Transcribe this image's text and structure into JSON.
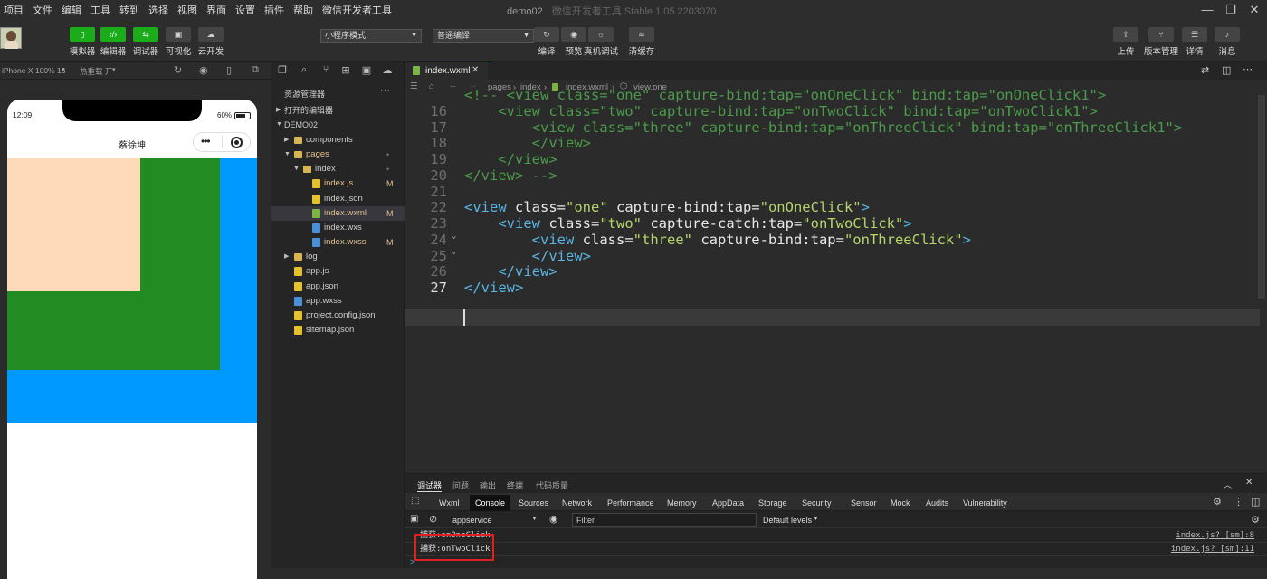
{
  "menu": [
    "项目",
    "文件",
    "编辑",
    "工具",
    "转到",
    "选择",
    "视图",
    "界面",
    "设置",
    "插件",
    "帮助",
    "微信开发者工具"
  ],
  "window": {
    "title": "demo02",
    "subtitle": "微信开发者工具 Stable 1.05.2203070"
  },
  "toolbar": {
    "buttons": [
      {
        "icon": "phone-icon",
        "label": "模拟器"
      },
      {
        "icon": "code-icon",
        "label": "编辑器"
      },
      {
        "icon": "debug-icon",
        "label": "调试器"
      },
      {
        "icon": "visual-icon",
        "label": "可视化"
      },
      {
        "icon": "cloud-icon",
        "label": "云开发"
      }
    ],
    "mode_select": "小程序模式",
    "compile_select": "普通编译",
    "actions": [
      "编译",
      "预览",
      "真机调试",
      "清缓存"
    ],
    "right_actions": [
      "上传",
      "版本管理",
      "详情",
      "消息"
    ]
  },
  "simulator": {
    "device": "iPhone X 100% 16",
    "hotreload": "热重载 开",
    "time": "12:09",
    "battery": "60%",
    "nav_title": "蔡徐坤",
    "colors": {
      "blue": "#0099ff",
      "green": "#228b22",
      "peach": "#ffdab9"
    }
  },
  "explorer": {
    "title": "资源管理器",
    "open_editors": "打开的编辑器",
    "project": "DEMO02",
    "tree": [
      {
        "name": "components",
        "type": "folder",
        "depth": 1,
        "open": false,
        "status": ""
      },
      {
        "name": "pages",
        "type": "folder",
        "depth": 1,
        "open": true,
        "status": "•",
        "color": "#e2c08d"
      },
      {
        "name": "index",
        "type": "folder",
        "depth": 2,
        "open": true,
        "status": "•"
      },
      {
        "name": "index.js",
        "type": "js",
        "depth": 3,
        "status": "M",
        "color": "#e2c08d"
      },
      {
        "name": "index.json",
        "type": "json",
        "depth": 3,
        "status": ""
      },
      {
        "name": "index.wxml",
        "type": "wxml",
        "depth": 3,
        "status": "M",
        "color": "#e2c08d",
        "selected": true
      },
      {
        "name": "index.wxs",
        "type": "wxs",
        "depth": 3,
        "status": ""
      },
      {
        "name": "index.wxss",
        "type": "wxss",
        "depth": 3,
        "status": "M",
        "color": "#e2c08d"
      },
      {
        "name": "log",
        "type": "folder",
        "depth": 1,
        "open": false,
        "status": ""
      },
      {
        "name": "app.js",
        "type": "js",
        "depth": 1,
        "status": ""
      },
      {
        "name": "app.json",
        "type": "json",
        "depth": 1,
        "status": ""
      },
      {
        "name": "app.wxss",
        "type": "wxss",
        "depth": 1,
        "status": ""
      },
      {
        "name": "project.config.json",
        "type": "json",
        "depth": 1,
        "status": ""
      },
      {
        "name": "sitemap.json",
        "type": "json",
        "depth": 1,
        "status": ""
      }
    ]
  },
  "editor": {
    "tab": "index.wxml",
    "breadcrumb": [
      "pages",
      "index",
      "index.wxml",
      "view.one"
    ],
    "lines": [
      {
        "n": "",
        "segs": [
          [
            "cm",
            "<!-- <view class=\"one\" capture-bind:tap=\"onOneClick\" bind:tap=\"onOneClick1\">"
          ]
        ]
      },
      {
        "n": "16",
        "segs": [
          [
            "cm",
            "    <view class=\"two\" capture-bind:tap=\"onTwoClick\" bind:tap=\"onTwoClick1\">"
          ]
        ]
      },
      {
        "n": "17",
        "segs": [
          [
            "cm",
            "        <view class=\"three\" capture-bind:tap=\"onThreeClick\" bind:tap=\"onThreeClick1\">"
          ]
        ]
      },
      {
        "n": "18",
        "segs": [
          [
            "cm",
            "        </view>"
          ]
        ]
      },
      {
        "n": "19",
        "segs": [
          [
            "cm",
            "    </view>"
          ]
        ]
      },
      {
        "n": "20",
        "segs": [
          [
            "cm",
            "</view> -->"
          ]
        ]
      },
      {
        "n": "21",
        "segs": []
      },
      {
        "n": "22",
        "segs": [
          [
            "tg",
            "<view "
          ],
          [
            "at",
            "class="
          ],
          [
            "sv",
            "\"one\" "
          ],
          [
            "at",
            "capture-bind:tap="
          ],
          [
            "sv",
            "\"onOneClick\""
          ],
          [
            "tg",
            ">"
          ]
        ]
      },
      {
        "n": "23",
        "segs": [
          [
            "tg",
            "    <view "
          ],
          [
            "at",
            "class="
          ],
          [
            "sv",
            "\"two\" "
          ],
          [
            "at",
            "capture-catch:tap="
          ],
          [
            "sv",
            "\"onTwoClick\""
          ],
          [
            "tg",
            ">"
          ]
        ]
      },
      {
        "n": "24",
        "segs": [
          [
            "tg",
            "        <view "
          ],
          [
            "at",
            "class="
          ],
          [
            "sv",
            "\"three\" "
          ],
          [
            "at",
            "capture-bind:tap="
          ],
          [
            "sv",
            "\"onThreeClick\""
          ],
          [
            "tg",
            ">"
          ]
        ]
      },
      {
        "n": "25",
        "segs": [
          [
            "tg",
            "        </view>"
          ]
        ]
      },
      {
        "n": "26",
        "segs": [
          [
            "tg",
            "    </view>"
          ]
        ]
      },
      {
        "n": "27",
        "segs": [
          [
            "tg",
            "</view>"
          ]
        ]
      }
    ]
  },
  "devtools": {
    "panel_tabs": [
      "调试器",
      "问题",
      "输出",
      "终端",
      "代码质量"
    ],
    "tabs": [
      "Wxml",
      "Console",
      "Sources",
      "Network",
      "Performance",
      "Memory",
      "AppData",
      "Storage",
      "Security",
      "Sensor",
      "Mock",
      "Audits",
      "Vulnerability"
    ],
    "active_tab": "Console",
    "context": "appservice",
    "filter_placeholder": "Filter",
    "levels": "Default levels",
    "logs": [
      {
        "text": "捕获:onOneClick",
        "source": "index.js? [sm]:8"
      },
      {
        "text": "捕获:onTwoClick",
        "source": "index.js? [sm]:11"
      }
    ],
    "prompt": ">"
  }
}
